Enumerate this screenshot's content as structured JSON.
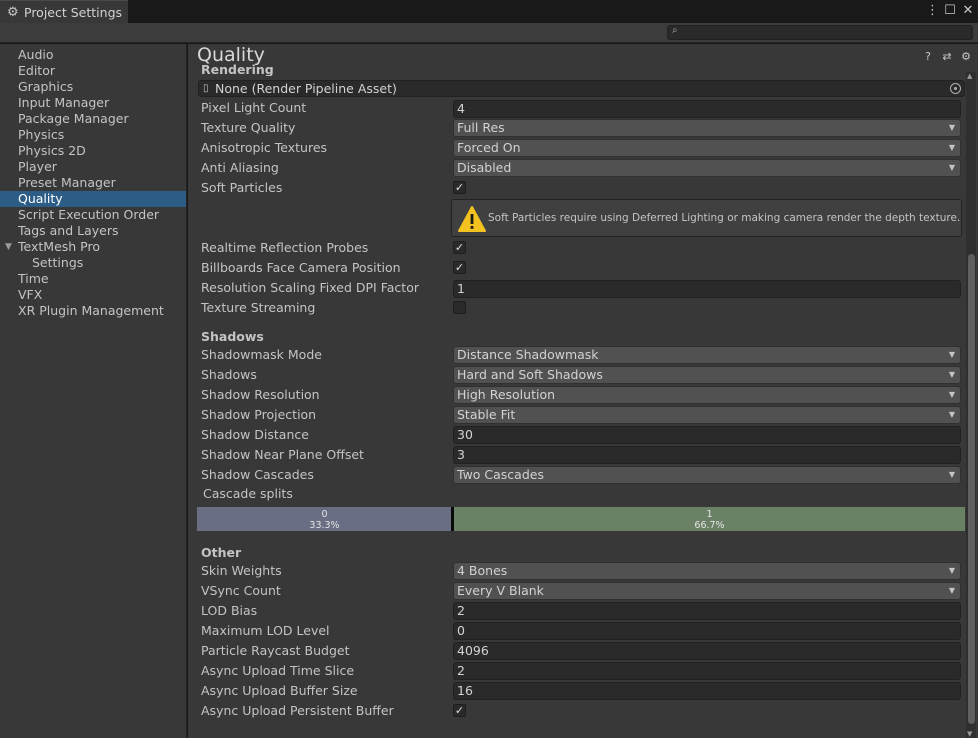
{
  "window": {
    "tab_title": "Project Settings",
    "icons": [
      "gear-icon",
      "kebab-menu-icon",
      "maximize-icon",
      "close-icon"
    ],
    "kebab": "⋮",
    "maximize": "☐",
    "close": "✕"
  },
  "search": {
    "placeholder": "",
    "value": ""
  },
  "sidebar": {
    "items": [
      {
        "label": "Audio"
      },
      {
        "label": "Editor"
      },
      {
        "label": "Graphics"
      },
      {
        "label": "Input Manager"
      },
      {
        "label": "Package Manager"
      },
      {
        "label": "Physics"
      },
      {
        "label": "Physics 2D"
      },
      {
        "label": "Player"
      },
      {
        "label": "Preset Manager"
      },
      {
        "label": "Quality",
        "selected": true
      },
      {
        "label": "Script Execution Order"
      },
      {
        "label": "Tags and Layers"
      },
      {
        "label": "TextMesh Pro",
        "expanded": true
      },
      {
        "label": "Settings",
        "child": true
      },
      {
        "label": "Time"
      },
      {
        "label": "VFX"
      },
      {
        "label": "XR Plugin Management"
      }
    ]
  },
  "main": {
    "title": "Quality",
    "header_icons": [
      "help-icon",
      "preset-icon",
      "settings-icon"
    ],
    "rendering": {
      "section": "Rendering",
      "pipeline_asset": "None (Render Pipeline Asset)",
      "pixel_light_count": {
        "label": "Pixel Light Count",
        "value": "4"
      },
      "texture_quality": {
        "label": "Texture Quality",
        "value": "Full Res"
      },
      "anisotropic_textures": {
        "label": "Anisotropic Textures",
        "value": "Forced On"
      },
      "anti_aliasing": {
        "label": "Anti Aliasing",
        "value": "Disabled"
      },
      "soft_particles": {
        "label": "Soft Particles",
        "checked": true
      },
      "soft_particles_warning": "Soft Particles require using Deferred Lighting or making camera render the depth texture.",
      "realtime_reflection_probes": {
        "label": "Realtime Reflection Probes",
        "checked": true
      },
      "billboards_face_camera": {
        "label": "Billboards Face Camera Position",
        "checked": true
      },
      "resolution_scaling": {
        "label": "Resolution Scaling Fixed DPI Factor",
        "value": "1"
      },
      "texture_streaming": {
        "label": "Texture Streaming",
        "checked": false
      }
    },
    "shadows": {
      "section": "Shadows",
      "shadowmask_mode": {
        "label": "Shadowmask Mode",
        "value": "Distance Shadowmask"
      },
      "shadows": {
        "label": "Shadows",
        "value": "Hard and Soft Shadows"
      },
      "shadow_resolution": {
        "label": "Shadow Resolution",
        "value": "High Resolution"
      },
      "shadow_projection": {
        "label": "Shadow Projection",
        "value": "Stable Fit"
      },
      "shadow_distance": {
        "label": "Shadow Distance",
        "value": "30"
      },
      "shadow_near_plane_offset": {
        "label": "Shadow Near Plane Offset",
        "value": "3"
      },
      "shadow_cascades": {
        "label": "Shadow Cascades",
        "value": "Two Cascades"
      },
      "cascade_splits": {
        "label": "Cascade splits",
        "segments": [
          {
            "index": "0",
            "percent": "33.3%",
            "color": "#6a6e84",
            "fraction": 0.333
          },
          {
            "index": "1",
            "percent": "66.7%",
            "color": "#6a8166",
            "fraction": 0.667
          }
        ]
      }
    },
    "other": {
      "section": "Other",
      "skin_weights": {
        "label": "Skin Weights",
        "value": "4 Bones"
      },
      "vsync_count": {
        "label": "VSync Count",
        "value": "Every V Blank"
      },
      "lod_bias": {
        "label": "LOD Bias",
        "value": "2"
      },
      "maximum_lod_level": {
        "label": "Maximum LOD Level",
        "value": "0"
      },
      "particle_raycast_budget": {
        "label": "Particle Raycast Budget",
        "value": "4096"
      },
      "async_upload_time_slice": {
        "label": "Async Upload Time Slice",
        "value": "2"
      },
      "async_upload_buffer_size": {
        "label": "Async Upload Buffer Size",
        "value": "16"
      },
      "async_upload_persistent_buffer": {
        "label": "Async Upload Persistent Buffer",
        "checked": true
      }
    }
  },
  "colors": {
    "selection": "#2c5d87",
    "panel": "#383838",
    "warning_icon": "#f4c21f"
  }
}
